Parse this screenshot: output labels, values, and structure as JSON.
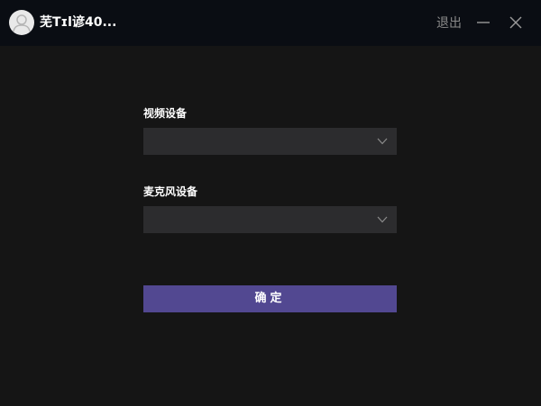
{
  "header": {
    "user_name": "芜Tɪl谚40...",
    "logout_label": "退出",
    "avatar_icon": "user-avatar-icon",
    "minimize_icon": "minimize-icon",
    "close_icon": "close-icon"
  },
  "form": {
    "video_device": {
      "label": "视频设备",
      "value": ""
    },
    "microphone_device": {
      "label": "麦克风设备",
      "value": ""
    },
    "confirm_label": "确定"
  },
  "colors": {
    "background": "#151515",
    "titlebar": "#0a0d13",
    "select_bg": "#2c2c2e",
    "accent": "#524891"
  }
}
